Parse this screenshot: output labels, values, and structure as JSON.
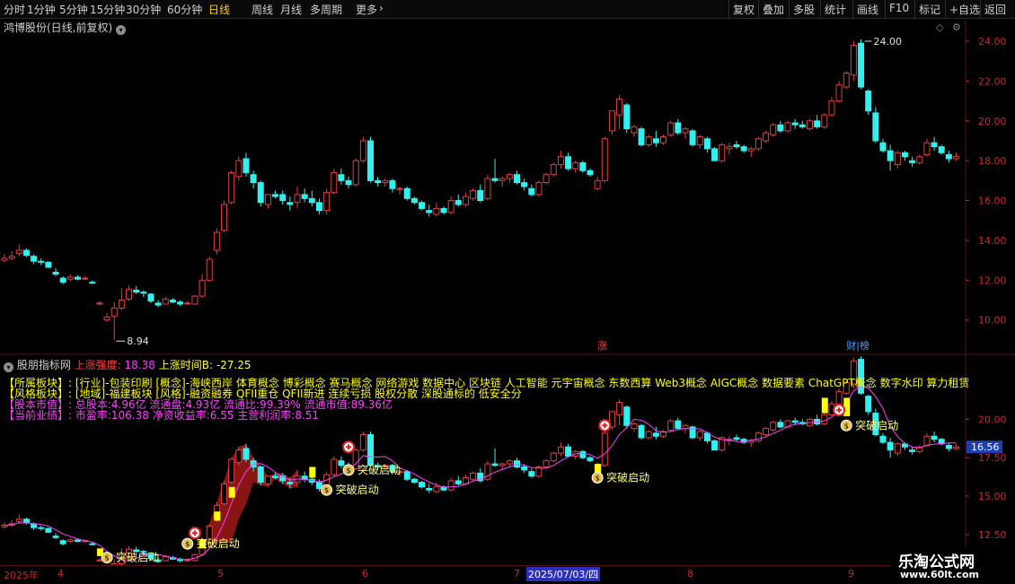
{
  "toolbar": {
    "periods": [
      "分时",
      "1分钟",
      "5分钟",
      "15分钟",
      "30分钟",
      "60分钟",
      "日线",
      "周线",
      "月线",
      "多周期",
      "更多"
    ],
    "active_period": "日线",
    "more_icon": "chevron-right-icon",
    "right_buttons": [
      "复权",
      "叠加",
      "多股",
      "统计",
      "画线",
      "F10",
      "标记",
      "+自选",
      "返回"
    ]
  },
  "main_chart": {
    "title": "鸿博股份(日线,前复权)",
    "title_menu_icon": "chevron-down-icon",
    "y_ticks": [
      "24.00",
      "22.00",
      "20.00",
      "18.00",
      "16.00",
      "14.00",
      "12.00",
      "10.00"
    ],
    "high_label": "24.00",
    "low_label": "8.94",
    "markers": [
      "涨",
      "财|榜"
    ],
    "corner_icons": [
      "diamond-icon",
      "settings-icon"
    ]
  },
  "indicator": {
    "name": "股朋指标网",
    "strength_label": "上涨强度: ",
    "strength_value": "18.38",
    "time_label": "上涨时间B: ",
    "time_value": "-27.25",
    "info": {
      "industry": "【所属板块】: [行业]-包装印刷 [概念]-海峡西岸 体育概念 博彩概念 赛马概念 网络游戏 数据中心 区块链 人工智能 元宇宙概念 东数西算 Web3概念 AIGC概念 数据要素 ChatGPT概念 数字水印 算力租赁",
      "style": "【风格板块】: [地域]-福建板块 [风格]-融资融券 QFII重仓 QFII新进 连续亏损 股权分散 深股通标的 低安全分",
      "equity": "【股本市值】: 总股本:4.96亿 流通盘:4.93亿 流通比:99.39% 流通市值:89.36亿",
      "performance": "【当前业绩】: 市盈率:106.38 净资收益率:6.55 主营利润率:8.51"
    },
    "y_ticks": [
      "20.00",
      "17.50",
      "15.00",
      "12.50"
    ],
    "current_price": "16.56",
    "signal_text": "突破启动"
  },
  "x_axis": {
    "year": "2025年",
    "months": [
      "4",
      "5",
      "6",
      "7",
      "8",
      "9"
    ],
    "cursor_date": "2025/07/03/四"
  },
  "watermark": {
    "title": "乐淘公式网",
    "url": "www.60lt.com"
  },
  "colors": {
    "up": "#e04040",
    "down": "#30f0f0",
    "yellow": "#ffff00",
    "magenta": "#ff40ff",
    "grid": "#5a1010",
    "label": "#c8282d",
    "signal": "#ffff80"
  },
  "chart_data": {
    "type": "candlestick",
    "candles": [
      [
        13.0,
        13.3,
        12.9,
        13.1
      ],
      [
        13.1,
        13.45,
        13.0,
        13.2
      ],
      [
        13.35,
        13.8,
        13.2,
        13.5
      ],
      [
        13.5,
        13.6,
        13.15,
        13.25
      ],
      [
        13.2,
        13.3,
        12.8,
        12.95
      ],
      [
        12.95,
        13.1,
        12.75,
        12.9
      ],
      [
        12.9,
        12.95,
        12.6,
        12.65
      ],
      [
        12.4,
        12.6,
        12.2,
        12.3
      ],
      [
        12.1,
        12.2,
        11.8,
        11.9
      ],
      [
        12.05,
        12.3,
        11.95,
        12.15
      ],
      [
        12.15,
        12.25,
        12.0,
        12.05
      ],
      [
        12.1,
        12.2,
        12.0,
        12.1
      ],
      [
        11.9,
        12.0,
        11.8,
        11.85
      ],
      [
        10.8,
        10.95,
        10.75,
        10.85
      ],
      [
        10.0,
        10.35,
        9.9,
        10.15
      ],
      [
        10.2,
        10.9,
        9.0,
        10.6
      ],
      [
        10.6,
        11.6,
        10.5,
        11.0
      ],
      [
        11.05,
        11.75,
        10.95,
        11.55
      ],
      [
        11.5,
        11.7,
        11.3,
        11.4
      ],
      [
        11.4,
        11.5,
        11.15,
        11.35
      ],
      [
        11.3,
        11.35,
        10.85,
        10.95
      ],
      [
        10.85,
        11.0,
        10.65,
        10.75
      ],
      [
        10.8,
        11.15,
        10.75,
        11.05
      ],
      [
        11.0,
        11.1,
        10.85,
        10.9
      ],
      [
        10.9,
        11.0,
        10.7,
        10.8
      ],
      [
        10.85,
        10.95,
        10.75,
        10.85
      ],
      [
        10.8,
        11.25,
        10.75,
        11.2
      ],
      [
        11.2,
        12.3,
        11.1,
        12.0
      ],
      [
        12.0,
        13.2,
        11.9,
        13.05
      ],
      [
        13.5,
        14.6,
        13.3,
        14.4
      ],
      [
        14.5,
        16.0,
        14.4,
        15.8
      ],
      [
        15.9,
        17.5,
        15.8,
        17.4
      ],
      [
        17.2,
        18.2,
        17.0,
        18.0
      ],
      [
        18.1,
        18.4,
        17.2,
        17.4
      ],
      [
        17.3,
        17.5,
        16.6,
        16.9
      ],
      [
        16.9,
        17.0,
        15.7,
        15.9
      ],
      [
        15.8,
        16.3,
        15.6,
        16.3
      ],
      [
        16.3,
        16.5,
        16.1,
        16.2
      ],
      [
        16.3,
        16.5,
        15.8,
        16.0
      ],
      [
        15.9,
        16.2,
        15.5,
        15.8
      ],
      [
        15.9,
        16.7,
        15.6,
        16.3
      ],
      [
        16.3,
        16.6,
        15.9,
        16.1
      ],
      [
        16.1,
        16.5,
        15.7,
        15.9
      ],
      [
        15.9,
        16.1,
        15.3,
        15.5
      ],
      [
        15.5,
        16.6,
        15.3,
        16.4
      ],
      [
        16.4,
        17.6,
        16.3,
        17.4
      ],
      [
        17.3,
        17.6,
        16.8,
        17.0
      ],
      [
        17.0,
        17.2,
        16.6,
        16.8
      ],
      [
        16.8,
        18.1,
        16.7,
        18.0
      ],
      [
        18.0,
        19.2,
        17.9,
        19.0
      ],
      [
        19.0,
        19.2,
        16.9,
        17.0
      ],
      [
        17.0,
        17.2,
        16.7,
        16.9
      ],
      [
        16.9,
        17.1,
        16.7,
        17.0
      ],
      [
        17.0,
        17.1,
        16.4,
        16.6
      ],
      [
        16.6,
        16.7,
        16.3,
        16.6
      ],
      [
        16.6,
        16.7,
        16.0,
        16.1
      ],
      [
        16.1,
        16.2,
        15.8,
        15.9
      ],
      [
        15.9,
        16.0,
        15.5,
        15.6
      ],
      [
        15.5,
        15.8,
        15.2,
        15.4
      ],
      [
        15.3,
        15.9,
        15.2,
        15.6
      ],
      [
        15.6,
        15.7,
        15.3,
        15.4
      ],
      [
        15.4,
        16.2,
        15.3,
        16.0
      ],
      [
        16.0,
        16.3,
        15.7,
        15.8
      ],
      [
        15.8,
        16.4,
        15.7,
        16.2
      ],
      [
        16.1,
        16.6,
        16.0,
        16.5
      ],
      [
        16.5,
        16.8,
        15.9,
        16.0
      ],
      [
        16.1,
        17.3,
        16.0,
        17.1
      ],
      [
        17.1,
        18.1,
        16.9,
        17.0
      ],
      [
        17.0,
        17.2,
        16.7,
        17.1
      ],
      [
        17.1,
        17.4,
        16.9,
        17.3
      ],
      [
        17.3,
        17.5,
        16.8,
        16.9
      ],
      [
        16.9,
        17.1,
        16.5,
        16.7
      ],
      [
        16.6,
        16.8,
        16.2,
        16.3
      ],
      [
        16.3,
        17.0,
        16.2,
        16.9
      ],
      [
        16.9,
        17.4,
        16.8,
        17.3
      ],
      [
        17.3,
        17.9,
        17.2,
        17.8
      ],
      [
        17.8,
        18.5,
        17.6,
        18.2
      ],
      [
        18.2,
        18.4,
        17.5,
        17.6
      ],
      [
        17.6,
        18.0,
        17.4,
        17.9
      ],
      [
        17.9,
        18.0,
        17.4,
        17.5
      ],
      [
        17.5,
        17.6,
        17.2,
        17.3
      ],
      [
        16.6,
        17.2,
        16.5,
        17.0
      ],
      [
        17.0,
        19.2,
        16.9,
        19.1
      ],
      [
        19.5,
        20.2,
        19.3,
        20.5
      ],
      [
        20.3,
        21.3,
        19.6,
        21.1
      ],
      [
        20.8,
        20.9,
        19.4,
        19.6
      ],
      [
        19.4,
        19.8,
        19.2,
        19.7
      ],
      [
        19.6,
        19.7,
        18.7,
        18.8
      ],
      [
        18.8,
        19.3,
        18.7,
        19.2
      ],
      [
        19.1,
        19.5,
        18.7,
        18.9
      ],
      [
        18.9,
        19.3,
        18.8,
        19.2
      ],
      [
        19.3,
        20.0,
        19.2,
        19.9
      ],
      [
        19.9,
        20.1,
        19.3,
        19.4
      ],
      [
        19.4,
        19.7,
        19.1,
        19.6
      ],
      [
        19.5,
        19.6,
        18.7,
        18.8
      ],
      [
        18.8,
        19.3,
        18.6,
        19.2
      ],
      [
        19.1,
        19.2,
        18.4,
        18.6
      ],
      [
        18.6,
        18.7,
        18.0,
        18.0
      ],
      [
        18.0,
        18.9,
        17.9,
        18.8
      ],
      [
        18.6,
        18.9,
        18.3,
        18.7
      ],
      [
        18.8,
        19.0,
        18.6,
        18.7
      ],
      [
        18.7,
        18.8,
        18.4,
        18.5
      ],
      [
        18.5,
        18.7,
        18.2,
        18.6
      ],
      [
        18.6,
        19.2,
        18.5,
        19.1
      ],
      [
        19.0,
        19.5,
        18.9,
        19.4
      ],
      [
        19.3,
        19.9,
        19.2,
        19.8
      ],
      [
        19.8,
        20.0,
        19.4,
        19.5
      ],
      [
        19.5,
        20.0,
        19.4,
        19.9
      ],
      [
        19.9,
        20.1,
        19.6,
        19.8
      ],
      [
        19.8,
        20.0,
        19.6,
        19.7
      ],
      [
        19.6,
        20.1,
        19.5,
        20.0
      ],
      [
        20.0,
        20.3,
        19.6,
        19.7
      ],
      [
        19.7,
        20.4,
        19.6,
        20.3
      ],
      [
        20.3,
        21.2,
        20.2,
        21.0
      ],
      [
        21.0,
        22.0,
        20.9,
        21.8
      ],
      [
        21.7,
        22.5,
        21.6,
        22.4
      ],
      [
        22.3,
        24.0,
        22.0,
        23.8
      ],
      [
        23.9,
        24.1,
        21.6,
        21.7
      ],
      [
        21.5,
        21.6,
        20.3,
        20.5
      ],
      [
        20.4,
        20.7,
        18.9,
        19.0
      ],
      [
        18.9,
        19.1,
        18.4,
        18.5
      ],
      [
        18.5,
        18.8,
        17.5,
        18.0
      ],
      [
        17.8,
        18.5,
        17.6,
        18.4
      ],
      [
        18.4,
        18.5,
        18.0,
        18.2
      ],
      [
        18.0,
        18.2,
        17.7,
        17.9
      ],
      [
        17.9,
        18.3,
        17.8,
        18.2
      ],
      [
        18.3,
        19.1,
        18.2,
        18.9
      ],
      [
        18.9,
        19.2,
        18.5,
        18.7
      ],
      [
        18.7,
        18.8,
        18.3,
        18.4
      ],
      [
        18.3,
        18.5,
        17.9,
        18.1
      ],
      [
        18.1,
        18.4,
        18.0,
        18.2
      ]
    ],
    "y_range": [
      8.5,
      24.9
    ],
    "high": 24.0,
    "low": 8.94
  }
}
